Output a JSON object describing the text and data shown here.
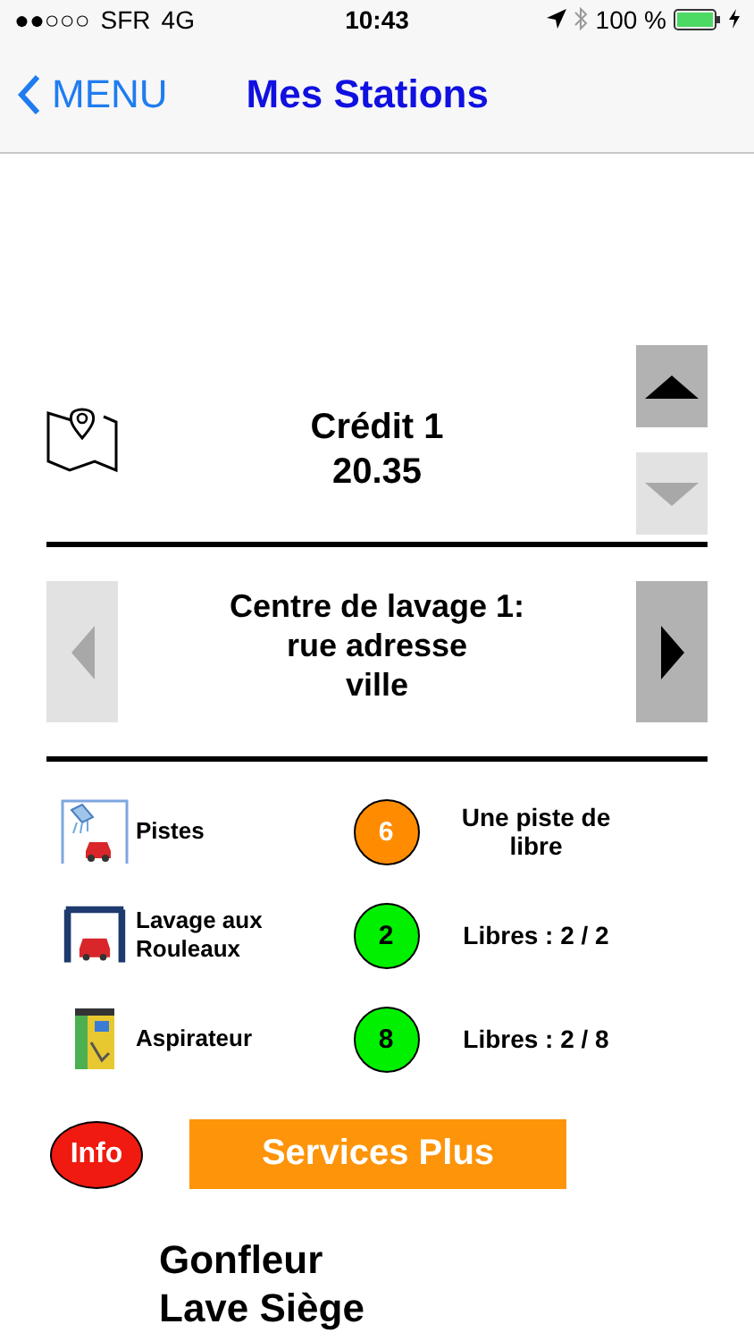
{
  "status_bar": {
    "signal": "●●○○○",
    "carrier": "SFR",
    "network": "4G",
    "time": "10:43",
    "battery": "100 %"
  },
  "nav": {
    "back": "MENU",
    "title": "Mes Stations"
  },
  "credit": {
    "label": "Crédit 1",
    "amount": "20.35",
    "up": {
      "disabled": false
    },
    "down": {
      "disabled": true
    }
  },
  "station": {
    "lines": [
      "Centre de lavage 1:",
      "rue adresse",
      "ville"
    ],
    "prev": {
      "disabled": true
    },
    "next": {
      "disabled": false
    }
  },
  "facilities": [
    {
      "kind": "tracks",
      "label": "Pistes",
      "count": "6",
      "color": "#ff8c00",
      "status": "Une piste de libre"
    },
    {
      "kind": "rollers",
      "label": "Lavage aux Rouleaux",
      "count": "2",
      "color": "#00f000",
      "status": "Libres : 2 / 2"
    },
    {
      "kind": "vacuum",
      "label": "Aspirateur",
      "count": "8",
      "color": "#00f000",
      "status": "Libres : 2 / 8"
    }
  ],
  "info_button": "Info",
  "services_button": "Services Plus",
  "footer_lines": [
    "Gonfleur",
    "Lave Siège"
  ]
}
